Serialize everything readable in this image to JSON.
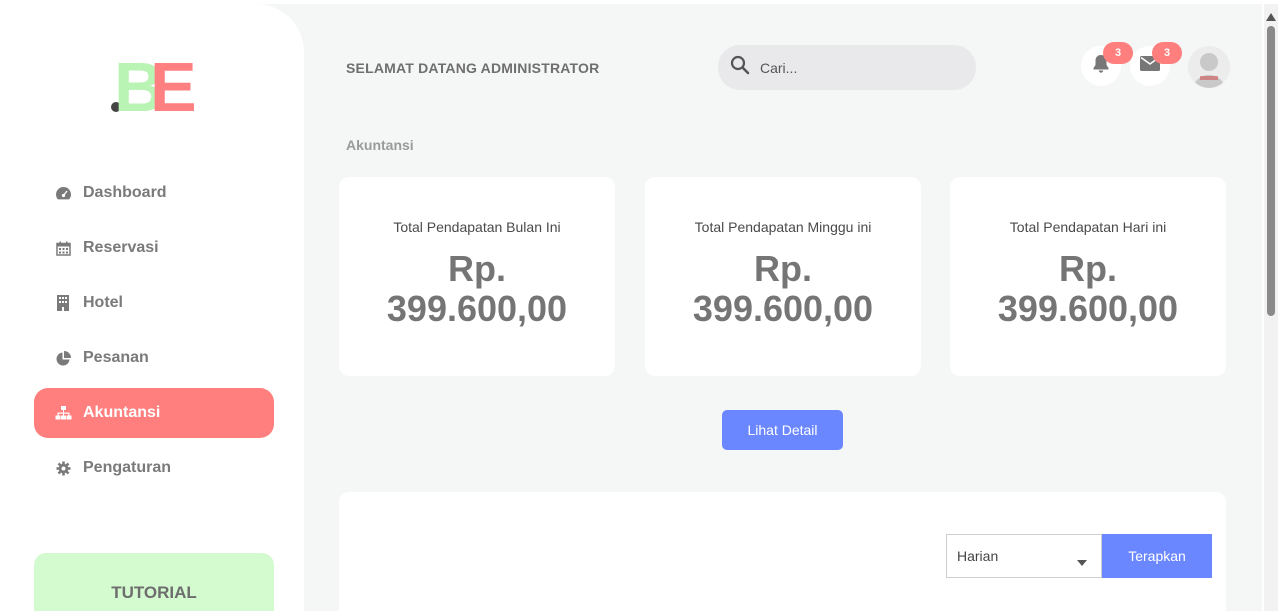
{
  "header": {
    "greeting": "SELAMAT DATANG ADMINISTRATOR",
    "search_placeholder": "Cari...",
    "notifications_count": "3",
    "messages_count": "3"
  },
  "sidebar": {
    "items": [
      {
        "label": "Dashboard",
        "icon": "dashboard-icon"
      },
      {
        "label": "Reservasi",
        "icon": "calendar-icon"
      },
      {
        "label": "Hotel",
        "icon": "building-icon"
      },
      {
        "label": "Pesanan",
        "icon": "pie-chart-icon"
      },
      {
        "label": "Akuntansi",
        "icon": "sitemap-icon",
        "active": true
      },
      {
        "label": "Pengaturan",
        "icon": "gear-icon"
      }
    ],
    "tutorial_label": "TUTORIAL"
  },
  "main": {
    "section_label": "Akuntansi",
    "cards": [
      {
        "title": "Total Pendapatan Bulan Ini",
        "value_prefix": "Rp.",
        "value": "399.600,00"
      },
      {
        "title": "Total Pendapatan Minggu ini",
        "value_prefix": "Rp.",
        "value": "399.600,00"
      },
      {
        "title": "Total Pendapatan Hari ini",
        "value_prefix": "Rp.",
        "value": "399.600,00"
      }
    ],
    "detail_button": "Lihat Detail",
    "filter": {
      "selected": "Harian",
      "apply_button": "Terapkan"
    }
  },
  "colors": {
    "accent_red": "#ff7f7f",
    "accent_green": "#d4fbcf",
    "primary_blue": "#6b87ff"
  }
}
